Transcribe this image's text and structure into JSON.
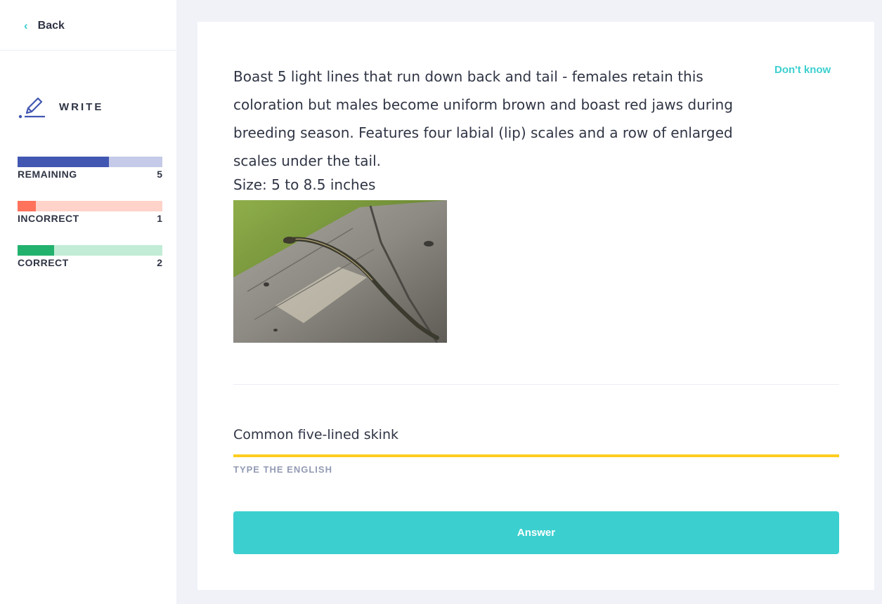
{
  "nav": {
    "back_label": "Back"
  },
  "mode": {
    "label": "WRITE"
  },
  "stats": {
    "remaining": {
      "label": "REMAINING",
      "count": "5",
      "progress": 0.63,
      "color": "#4257b2",
      "track": "#c4cae8"
    },
    "incorrect": {
      "label": "INCORRECT",
      "count": "1",
      "progress": 0.125,
      "color": "#ff725b",
      "track": "#ffd2ca"
    },
    "correct": {
      "label": "CORRECT",
      "count": "2",
      "progress": 0.25,
      "color": "#23b26d",
      "track": "#c2ecd6"
    }
  },
  "question": {
    "prompt": "Boast 5 light lines that run down back and tail - females retain this coloration but males become uniform brown and boast red jaws during breeding season. Features four labial (lip) scales and a row of enlarged scales under the tail.",
    "size": "Size: 5 to 8.5 inches",
    "dont_know_label": "Don't know"
  },
  "answer": {
    "value": "Common five-lined skink",
    "hint": "TYPE THE ENGLISH",
    "button_label": "Answer"
  },
  "colors": {
    "accent": "#3ccfcf",
    "input_underline": "#ffcd1f"
  }
}
